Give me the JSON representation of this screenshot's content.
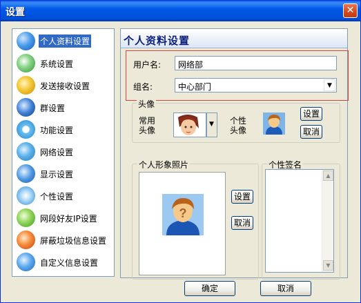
{
  "window": {
    "title": "设置",
    "close_glyph": "✕"
  },
  "sidebar": {
    "items": [
      {
        "label": "个人资料设置",
        "icon": "globe-icon",
        "color": "#1E73D8"
      },
      {
        "label": "系统设置",
        "icon": "system-icon",
        "color": "#3AAA3A"
      },
      {
        "label": "发送接收设置",
        "icon": "send-receive-icon",
        "color": "#E8B21A"
      },
      {
        "label": "群设置",
        "icon": "group-icon",
        "color": "#2A6CC4"
      },
      {
        "label": "功能设置",
        "icon": "function-icon",
        "color": "#2A9ADF"
      },
      {
        "label": "网络设置",
        "icon": "network-icon",
        "color": "#3E9ED8"
      },
      {
        "label": "显示设置",
        "icon": "display-icon",
        "color": "#2B7DD6"
      },
      {
        "label": "个性设置",
        "icon": "personal-icon",
        "color": "#2A8ADB"
      },
      {
        "label": "网段好友IP设置",
        "icon": "ip-icon",
        "color": "#5CB838"
      },
      {
        "label": "屏蔽垃圾信息设置",
        "icon": "block-icon",
        "color": "#E8631E"
      },
      {
        "label": "自定义信息设置",
        "icon": "custom-icon",
        "color": "#2E8BD8"
      }
    ],
    "active_index": 0
  },
  "panel": {
    "title": "个人资料设置"
  },
  "form": {
    "username_label": "用户名:",
    "username_value": "网络部",
    "group_label": "组名:",
    "group_value": "中心部门"
  },
  "avatar_group": {
    "legend": "头像",
    "common_label_line1": "常用",
    "common_label_line2": "头像",
    "custom_label_line1": "个性",
    "custom_label_line2": "头像",
    "set_label": "设置",
    "cancel_label": "取消"
  },
  "photo_group": {
    "legend": "个人形象照片",
    "set_label": "设置",
    "cancel_label": "取消"
  },
  "signature_group": {
    "legend": "个性签名"
  },
  "footer": {
    "ok_label": "确定",
    "cancel_label": "取消"
  },
  "colors": {
    "title_bar": "#0054E3",
    "highlight": "#316AC5",
    "red_frame": "#D9433A"
  }
}
